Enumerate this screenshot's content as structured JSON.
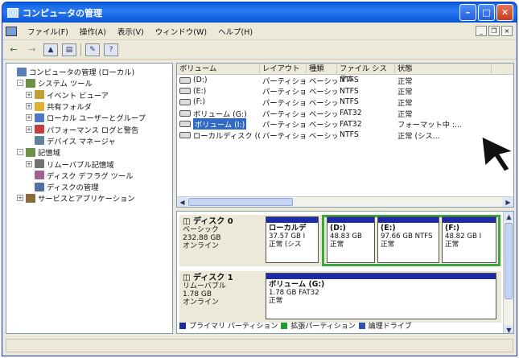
{
  "title": "コンピュータの管理",
  "menu": [
    "ファイル(F)",
    "操作(A)",
    "表示(V)",
    "ウィンドウ(W)",
    "ヘルプ(H)"
  ],
  "tree": [
    {
      "label": "コンピュータの管理 (ローカル)",
      "indent": 0,
      "exp": "",
      "color": "#5a7fb5"
    },
    {
      "label": "システム ツール",
      "indent": 1,
      "exp": "-",
      "color": "#6d8f4a"
    },
    {
      "label": "イベント ビューア",
      "indent": 2,
      "exp": "+",
      "color": "#c0a030"
    },
    {
      "label": "共有フォルダ",
      "indent": 2,
      "exp": "+",
      "color": "#e0b030"
    },
    {
      "label": "ローカル ユーザーとグループ",
      "indent": 2,
      "exp": "+",
      "color": "#4a7ac0"
    },
    {
      "label": "パフォーマンス ログと警告",
      "indent": 2,
      "exp": "+",
      "color": "#c04040"
    },
    {
      "label": "デバイス マネージャ",
      "indent": 2,
      "exp": "",
      "color": "#6080a0"
    },
    {
      "label": "記憶域",
      "indent": 1,
      "exp": "-",
      "color": "#6d8f4a"
    },
    {
      "label": "リムーバブル記憶域",
      "indent": 2,
      "exp": "+",
      "color": "#707070"
    },
    {
      "label": "ディスク デフラグ ツール",
      "indent": 2,
      "exp": "",
      "color": "#a06090"
    },
    {
      "label": "ディスクの管理",
      "indent": 2,
      "exp": "",
      "color": "#5070a0"
    },
    {
      "label": "サービスとアプリケーション",
      "indent": 1,
      "exp": "+",
      "color": "#8a6a3a"
    }
  ],
  "columns": [
    "ボリューム",
    "レイアウト",
    "種類",
    "ファイル システム",
    "状態"
  ],
  "volumes": [
    {
      "name": "(D:)",
      "layout": "パーティション",
      "type": "ベーシック",
      "fs": "NTFS",
      "status": "正常"
    },
    {
      "name": "(E:)",
      "layout": "パーティション",
      "type": "ベーシック",
      "fs": "NTFS",
      "status": "正常"
    },
    {
      "name": "(F:)",
      "layout": "パーティション",
      "type": "ベーシック",
      "fs": "NTFS",
      "status": "正常"
    },
    {
      "name": "ボリューム (G:)",
      "layout": "パーティション",
      "type": "ベーシック",
      "fs": "FAT32",
      "status": "正常"
    },
    {
      "name": "ボリューム (I:)",
      "layout": "パーティション",
      "type": "ベーシック",
      "fs": "FAT32",
      "status": "フォーマット中 :..."
    },
    {
      "name": "ローカルディスク (C:)",
      "layout": "パーティション",
      "type": "ベーシック",
      "fs": "NTFS",
      "status": "正常 (シス..."
    }
  ],
  "disk0": {
    "name": "ディスク 0",
    "type": "ベーシック",
    "size": "232.88 GB",
    "state": "オンライン",
    "parts": [
      {
        "name": "ローカルデ",
        "size": "37.57 GB I",
        "status": "正常 (シス"
      },
      {
        "name": "(D:)",
        "size": "48.83 GB",
        "status": "正常"
      },
      {
        "name": "(E:)",
        "size": "97.66 GB NTFS",
        "status": "正常"
      },
      {
        "name": "(F:)",
        "size": "48.82 GB I",
        "status": "正常"
      }
    ]
  },
  "disk1": {
    "name": "ディスク 1",
    "type": "リムーバブル",
    "size": "1.78 GB",
    "state": "オンライン",
    "part": {
      "name": "ボリューム (G:)",
      "size": "1.78 GB FAT32",
      "status": "正常"
    }
  },
  "legend": [
    "プライマリ パーティション",
    "拡張パーティション",
    "論理ドライブ"
  ],
  "colors": {
    "primary": "#1f2aa8",
    "extended": "#1aa02a",
    "logical": "#2f4fb8",
    "highlight": "#3aa83a"
  }
}
